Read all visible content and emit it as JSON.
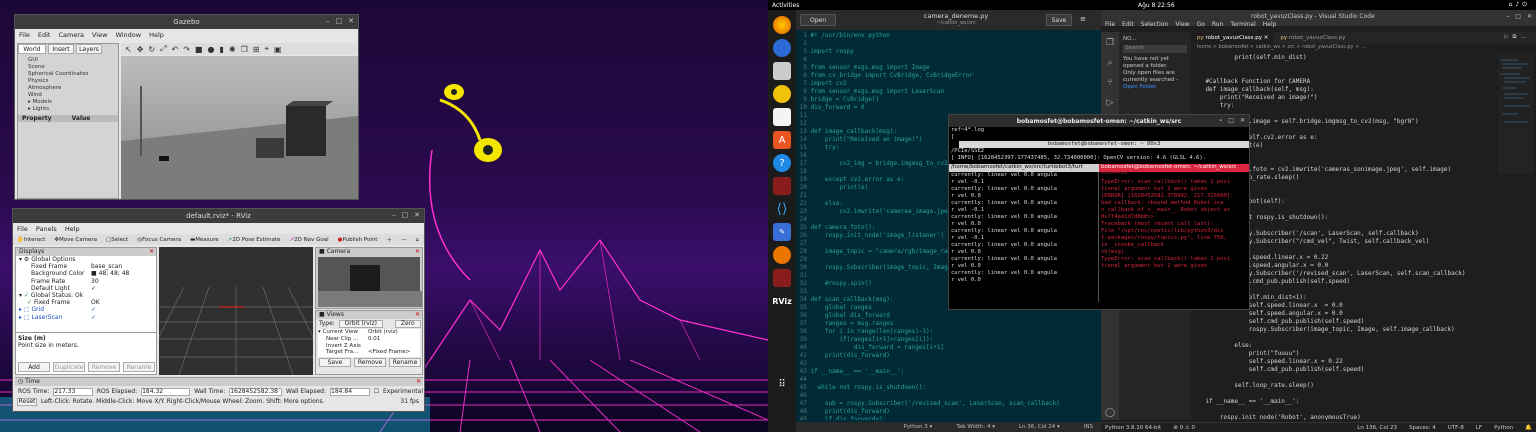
{
  "gazebo": {
    "title": "Gazebo",
    "menu": [
      "File",
      "Edit",
      "Camera",
      "View",
      "Window",
      "Help"
    ],
    "tabs": [
      "World",
      "Insert",
      "Layers"
    ],
    "tree": [
      "GUI",
      "Scene",
      "Spherical Coordinates",
      "Physics",
      "Atmosphere",
      "Wind",
      "Models",
      "Lights"
    ],
    "prop_header": [
      "Property",
      "Value"
    ]
  },
  "rviz": {
    "title": "default.rviz* - RViz",
    "menu": [
      "File",
      "Panels",
      "Help"
    ],
    "tools": [
      "Interact",
      "Move Camera",
      "Select",
      "Focus Camera",
      "Measure",
      "2D Pose Estimate",
      "2D Nav Goal",
      "Publish Point"
    ],
    "displays_title": "Displays",
    "displays": [
      [
        "Global Options",
        ""
      ],
      [
        "Fixed Frame",
        "base_scan"
      ],
      [
        "Background Color",
        "48; 48; 48"
      ],
      [
        "Frame Rate",
        "30"
      ],
      [
        "Default Light",
        "✓"
      ],
      [
        "Global Status: Ok",
        ""
      ],
      [
        "Fixed Frame",
        "OK"
      ],
      [
        "Grid",
        "✓"
      ],
      [
        "LaserScan",
        "✓"
      ]
    ],
    "desc_title": "Size (m)",
    "desc_text": "Point size in meters.",
    "display_buttons": [
      "Add",
      "Duplicate",
      "Remove",
      "Rename"
    ],
    "camera_title": "Camera",
    "views_title": "Views",
    "views_type_label": "Type:",
    "views_type": "Orbit (rviz)",
    "zero": "Zero",
    "views_rows": [
      [
        "Current View",
        "Orbit (rviz)"
      ],
      [
        "Near Clip ...",
        "0.01"
      ],
      [
        "Invert Z Axis",
        ""
      ],
      [
        "Target Fra...",
        "<Fixed Frame>"
      ]
    ],
    "views_buttons": [
      "Save",
      "Remove",
      "Rename"
    ],
    "time_title": "Time",
    "ros_time_label": "ROS Time:",
    "ros_time": "217.33",
    "ros_elapsed_label": "ROS Elapsed:",
    "ros_elapsed": "184.32",
    "wall_time_label": "Wall Time:",
    "wall_time": "1628452582.38",
    "wall_elapsed_label": "Wall Elapsed:",
    "wall_elapsed": "184.84",
    "experimental": "Experimental",
    "reset": "Reset",
    "hint": "Left-Click: Rotate. Middle-Click: Move X/Y. Right-Click/Mouse Wheel: Zoom. Shift: More options.",
    "fps": "31 fps"
  },
  "topbar": {
    "activities": "Activities",
    "clock": "Ağu 8  22:56"
  },
  "gedit": {
    "open": "Open",
    "title": "camera_deneme.py",
    "subtitle": "~/catkin_ws/src",
    "save": "Save",
    "lines": [
      "#! /usr/bin/env python",
      "",
      "import rospy",
      "",
      "from sensor_msgs.msg import Image",
      "from cv_bridge import CvBridge, CvBridgeError",
      "import cv2",
      "from sensor_msgs.msg import LaserScan",
      "bridge = CvBridge()",
      "dis_forward = 0",
      "",
      "",
      "def image_callback(msg):",
      "    print(\"Received an image!\")",
      "    try:",
      "",
      "        cv2_img = bridge.imgmsg_to_cv2(msg",
      "",
      "    except cv2.error as e:",
      "        print(e)",
      "",
      "    else:",
      "        cv2.imwrite('camerea_image.jpeg'",
      "",
      "def camera_foto():",
      "    rospy.init_node('image_listener')",
      "",
      "    image_topic = \"camera/rgb/image_raw\"",
      "",
      "    rospy.Subscriber(image_topic, Image,",
      "",
      "    #rospy.spin()",
      "",
      "def scan_callback(msg):",
      "    global ranges",
      "    global dis_forward",
      "    ranges = msg.ranges",
      "    for i in range(len(ranges)-1):",
      "        if(ranges[i+1]>ranges[i]):",
      "            dis_forward = ranges[i+1]",
      "    print(dis_forward)",
      "",
      "if __name__ == '__main__':",
      "",
      "  while not rospy.is_shutdown():",
      "",
      "    sub = rospy.Subscriber('/revised_scan', LaserScan, scan_callback)",
      "    print(dis_forward)",
      "    if dis_forward<1:",
      "        camera_foto()",
      "    else:",
      "        print(\"fuuuuu\")"
    ],
    "status": [
      "Python 3 ▾",
      "Tab Width: 4 ▾",
      "Ln 36, Col 24 ▾",
      "INS"
    ]
  },
  "terminal": {
    "title": "bobamosfet@bobamosfet-omen: ~/catkin_ws/src",
    "inner_title": "bobamosfet@bobamosfet-omen: ~ 80x3",
    "top_lines": [
      "ref~4*.log",
      "[",
      "",
      "/PCIe/SSE2",
      "[ INFO] [1628452397.177437485, 32.734000000]: OpenCV version: 4.6 (GLSL 4.6)."
    ],
    "tab_left": "/home/bobamosfet/catkin_ws/src/turtlebot3/turt",
    "tab_right": "bobamosfet@bobamosfet-omen: ~/catkin_ws/src",
    "left_lines": [
      "currently:      linear vel 0.0   angula",
      "r vel -0.1",
      "currently:      linear vel 0.0   angula",
      "r vel 0.0",
      "currently:      linear vel 0.0   angula",
      "r vel -0.1",
      "currently:      linear vel 0.0   angula",
      "r vel 0.0",
      "currently:      linear vel 0.0   angula",
      "r vel -0.1",
      "currently:      linear vel 0.0   angula",
      "r vel 0.0",
      "currently:      linear vel 0.0   angula",
      "r vel 0.0",
      "currently:      linear vel 0.0   angula",
      "r vel 0.0"
    ],
    "right_lines": [
      "  ^^^^^^^^",
      "TypeError: scan_callback() takes 1 posi",
      "tional argument but 2 were given",
      "",
      "[ERROR] [1628452582.378992, 217.315000]:",
      " bad callback: <bound method Robot.sca",
      "n_callback of <__main__.Robot object at",
      "0x7f4ad1d7d8b0>>",
      "Traceback (most recent call last):",
      "  File \"/opt/ros/noetic/lib/python3/dis",
      "t-packages/rospy/topics.py\", line 750,",
      "in _invoke_callback",
      "    cb(msg)",
      "TypeError: scan_callback() takes 1 posi",
      "tional argument but 2 were given"
    ]
  },
  "vscode": {
    "title": "robot_yavuzClass.py - Visual Studio Code",
    "menu": [
      "File",
      "Edit",
      "Selection",
      "View",
      "Go",
      "Run",
      "Terminal",
      "Help"
    ],
    "explorer_label": "NO...",
    "no_folder": "You have not yet opened a folder.",
    "no_folder2": "Only open files are currently searched -",
    "open_folder": "Open Folder",
    "search_ph": "Search",
    "tabs": [
      "robot_yavuzClass.py",
      "robot_yavuzClass.py"
    ],
    "breadcrumb": "home > bobamosfet > catkin_ws > src > robot_yavuzClass.py > ...",
    "lines": [
      "            print(self.min_dist)",
      "",
      "",
      "    #Callback Function for CAMERA",
      "    def image_callback(self, msg):",
      "        print(\"Received an image!\")",
      "        try:",
      "",
      "            self.image = self.bridge.imgmsg_to_cv2(msg, \"bgr8\")",
      "",
      "        except self.cv2.error as e:",
      "            print(e)",
      "",
      "        else:",
      "            self.foto = cv2.imwrite('cameras_sonimage.jpeg', self.image)",
      "        self.loop_rate.sleep()",
      "",
      "",
      "    def start_robot(self):",
      "",
      "        while not rospy.is_shutdown():",
      "",
      "            rospy.Subscriber('/scan', LaserScan, self.callback)",
      "            rospy.Subscriber(\"/cmd_vel\", Twist, self.callback_vel)",
      "",
      "            self.speed.linear.x = 0.22",
      "            self.speed.angular.x = 0.0",
      "            rospy.Subscriber('/revised_scan', LaserScan, self.scan_callback)",
      "            self.cmd_pub.publish(self.speed)",
      "",
      "            if(self.min_dist<1):",
      "                self.speed.linear.x  = 0.0",
      "                self.speed.angular.x = 0.0",
      "                self.cmd_pub.publish(self.speed)",
      "                rospy.Subscriber(image_topic, Image, self.image_callback)",
      "",
      "            else:",
      "                print(\"fuuuu\")",
      "                self.speed.linear.x = 0.22",
      "                self.cmd_pub.publish(self.speed)",
      "",
      "            self.loop_rate.sleep()",
      "",
      "    if __name__ == '__main__':",
      "",
      "        rospy.init_node('Robot', anonymousTrue)"
    ],
    "status_left": "Python 3.8.10 64-bit",
    "status_counts": "⊗ 0 ⚠ 0",
    "status_right": [
      "Ln 136, Col 23",
      "Spaces: 4",
      "UTF-8",
      "LF",
      "Python"
    ]
  },
  "dock_icons": [
    "firefox-icon",
    "thunderbird-icon",
    "files-icon",
    "rhythmbox-icon",
    "writer-icon",
    "software-icon",
    "help-icon",
    "terminal-icon",
    "vscode-icon",
    "text-editor-icon",
    "blender-icon",
    "terminal2-icon",
    "rviz-icon",
    "apps-grid-icon"
  ],
  "colors": {
    "gedit_bg": "#002b36",
    "vscode_bg": "#1e1e1e",
    "terminal_bg": "#000000",
    "error_red": "#d7263d",
    "neon_pink": "#ff2fd0",
    "neon_cyan": "#19e6ff"
  }
}
